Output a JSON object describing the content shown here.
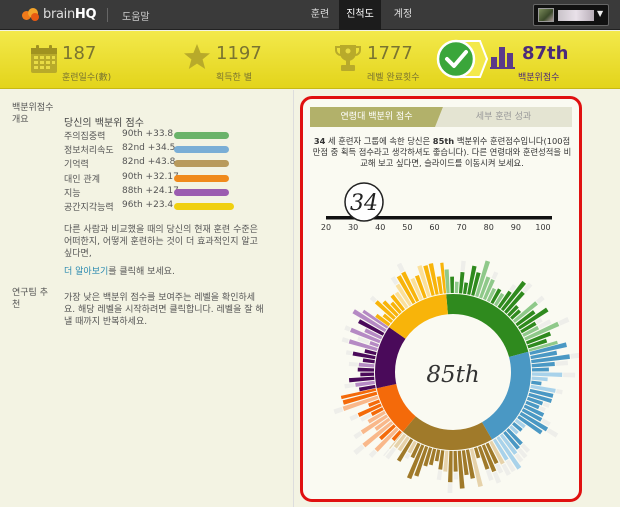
{
  "nav": {
    "brand_prefix": "brain",
    "brand_suffix": "HQ",
    "help": "도움말",
    "tabs": [
      {
        "label": "훈련",
        "active": false
      },
      {
        "label": "진척도",
        "active": true
      },
      {
        "label": "계정",
        "active": false
      }
    ]
  },
  "stats": [
    {
      "value": "187",
      "label": "훈련일수(數)",
      "icon": "calendar-icon"
    },
    {
      "value": "1197",
      "label": "획득한 별",
      "icon": "star-icon"
    },
    {
      "value": "1777",
      "label": "레벨 완료횟수",
      "icon": "trophy-icon"
    },
    {
      "value": "87th",
      "label": "백분위점수",
      "icon": "bar-chart-icon",
      "highlight": true
    }
  ],
  "left": {
    "summary_label": "백분위점수 개요",
    "summary_title": "당신의 백분위 점수",
    "metrics": [
      {
        "name": "주의집중력",
        "pct": "90th +33.8",
        "color": "#6ab36a",
        "level": 0.92
      },
      {
        "name": "정보처리속도",
        "pct": "82nd +34.5",
        "color": "#7aaed6",
        "level": 0.92
      },
      {
        "name": "기억력",
        "pct": "82nd +43.8",
        "color": "#b89a5c",
        "level": 0.92
      },
      {
        "name": "대인 관계",
        "pct": "90th +32.17",
        "color": "#f08a1c",
        "level": 0.92
      },
      {
        "name": "지능",
        "pct": "88th +24.17",
        "color": "#9b5cb0",
        "level": 0.92
      },
      {
        "name": "공간지각능력",
        "pct": "96th +23.4",
        "color": "#f0d010",
        "level": 1.0
      }
    ],
    "compare_text": "다른 사람과 비교했을 때의 당신의 현재 훈련 수준은 어떠한지, 어떻게 훈련하는 것이 더 효과적인지 알고 싶다면,",
    "more_link": "더 알아보기",
    "more_suffix": "를 클릭해 보세요.",
    "recommend_label": "연구팀 추천",
    "recommend_text": "가장 낮은 백분위 점수를 보여주는 레벨을 확인하세요. 해당 레벨을 시작하려면 클릭합니다. 레벨을 잘 해낼 때까지 반복하세요."
  },
  "panel": {
    "tab_active": "연령대 백분위 점수",
    "tab_inactive": "세부 훈련 성과",
    "desc_age": "34",
    "desc_part1": " 세 훈련자 그룹에 속한 당신은 ",
    "desc_pct": "85th",
    "desc_part2": " 백분위수 훈련점수입니다(100점 만점 중 획득 점수라고 생각하셔도 좋습니다). 다른 연령대와 훈련성적을 비교해 보고 싶다면, 슬라이드를 이동시켜 보세요.",
    "slider_value": "34",
    "slider_ticks": [
      "20",
      "30",
      "40",
      "50",
      "60",
      "70",
      "80",
      "90",
      "100"
    ],
    "center_label": "85th"
  },
  "colors": {
    "green": "#2f8a1e",
    "blue": "#4a98c4",
    "brown": "#a07a2a",
    "orange": "#f46a0a",
    "purple": "#4a0a5a",
    "yellow": "#f8b40a"
  }
}
